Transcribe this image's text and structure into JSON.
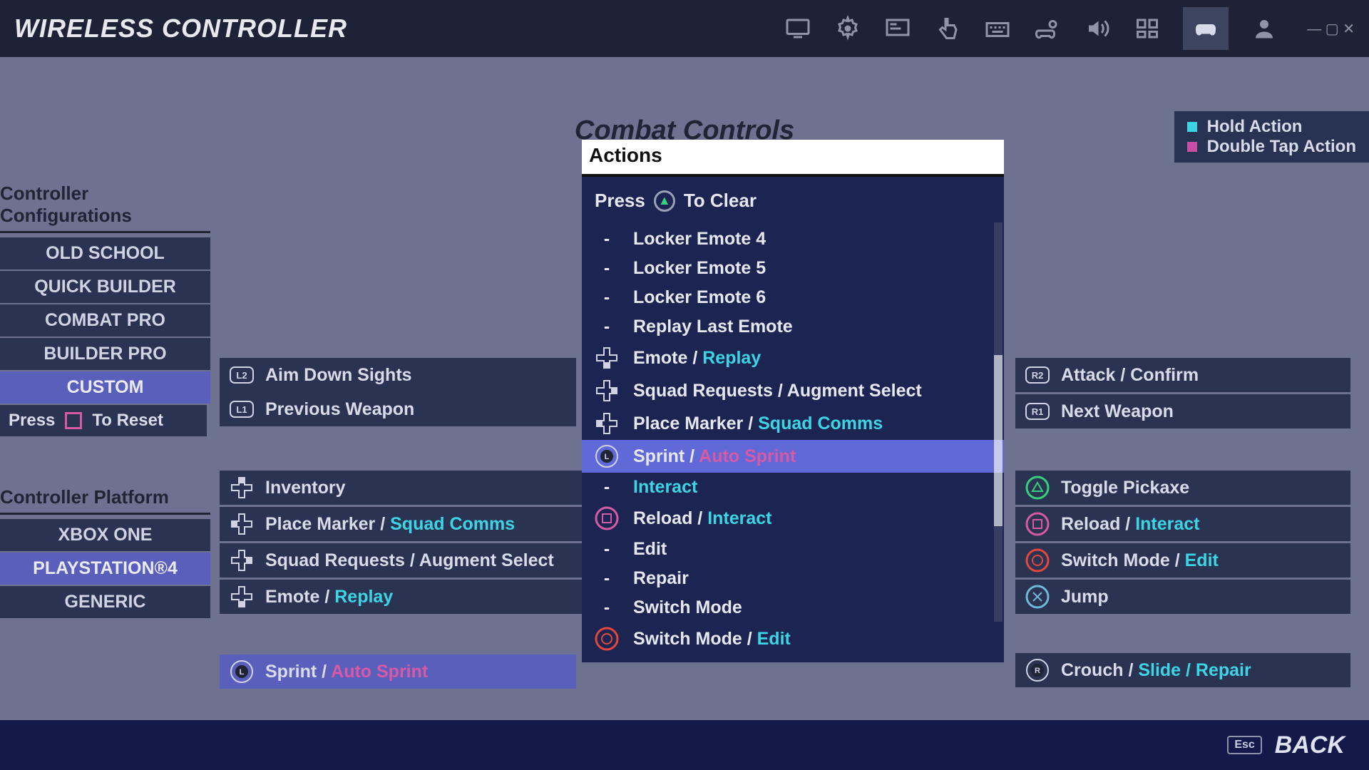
{
  "header": {
    "title": "WIRELESS CONTROLLER",
    "icons": [
      "monitor",
      "gear",
      "display-settings",
      "touch",
      "keyboard",
      "controller-gear",
      "volume",
      "accessibility",
      "controller",
      "user"
    ]
  },
  "section_title": "Combat Controls",
  "legend": {
    "hold": "Hold Action",
    "double": "Double Tap Action"
  },
  "sidebar": {
    "config_head": "Controller Configurations",
    "configs": [
      "OLD SCHOOL",
      "QUICK BUILDER",
      "COMBAT PRO",
      "BUILDER PRO",
      "CUSTOM"
    ],
    "selected_config": 4,
    "reset_press": "Press",
    "reset_text": "To Reset",
    "platform_head": "Controller Platform",
    "platforms": [
      "XBOX ONE",
      "PLAYSTATION®4",
      "GENERIC"
    ],
    "selected_platform": 1
  },
  "left_top": [
    {
      "icon": "L2",
      "text": "Aim Down Sights"
    },
    {
      "icon": "L1",
      "text": "Previous Weapon"
    }
  ],
  "left_bindings": [
    {
      "icon": "dpad-up",
      "text": "Inventory"
    },
    {
      "icon": "dpad-left",
      "text": "Place Marker / ",
      "hold": "Squad Comms"
    },
    {
      "icon": "dpad-right",
      "text": "Squad Requests / Augment Select"
    },
    {
      "icon": "dpad-down",
      "text": "Emote / ",
      "hold": "Replay"
    }
  ],
  "left_selected": {
    "icon": "L3",
    "text": "Sprint / ",
    "dbl": "Auto Sprint"
  },
  "right_top": [
    {
      "icon": "R2",
      "text": "Attack / Confirm"
    },
    {
      "icon": "R1",
      "text": "Next Weapon"
    }
  ],
  "right_bindings": [
    {
      "icon": "triangle",
      "text": "Toggle Pickaxe"
    },
    {
      "icon": "square",
      "text": "Reload / ",
      "hold": "Interact"
    },
    {
      "icon": "circle",
      "text": "Switch Mode / ",
      "hold": "Edit"
    },
    {
      "icon": "cross",
      "text": "Jump"
    }
  ],
  "right_extra": {
    "icon": "R3",
    "text": "Crouch / ",
    "hold": "Slide / Repair"
  },
  "popup": {
    "title": "Actions",
    "press": "Press",
    "to_clear": "To Clear",
    "items": [
      {
        "icon": "-",
        "text": "Locker Emote 4"
      },
      {
        "icon": "-",
        "text": "Locker Emote 5"
      },
      {
        "icon": "-",
        "text": "Locker Emote 6"
      },
      {
        "icon": "-",
        "text": "Replay Last Emote"
      },
      {
        "icon": "dpad-down",
        "text": "Emote / ",
        "hold": "Replay"
      },
      {
        "icon": "dpad-right",
        "text": "Squad Requests / Augment Select"
      },
      {
        "icon": "dpad-left",
        "text": "Place Marker / ",
        "hold": "Squad Comms"
      },
      {
        "icon": "L3",
        "text": "Sprint / ",
        "dbl": "Auto Sprint",
        "selected": true
      },
      {
        "icon": "-",
        "text": "",
        "hold": "Interact"
      },
      {
        "icon": "square",
        "text": "Reload / ",
        "hold": "Interact"
      },
      {
        "icon": "-",
        "text": "Edit"
      },
      {
        "icon": "-",
        "text": "Repair"
      },
      {
        "icon": "-",
        "text": "Switch Mode"
      },
      {
        "icon": "circle",
        "text": "Switch Mode / ",
        "hold": "Edit"
      }
    ]
  },
  "footer": {
    "esc": "Esc",
    "back": "BACK"
  }
}
